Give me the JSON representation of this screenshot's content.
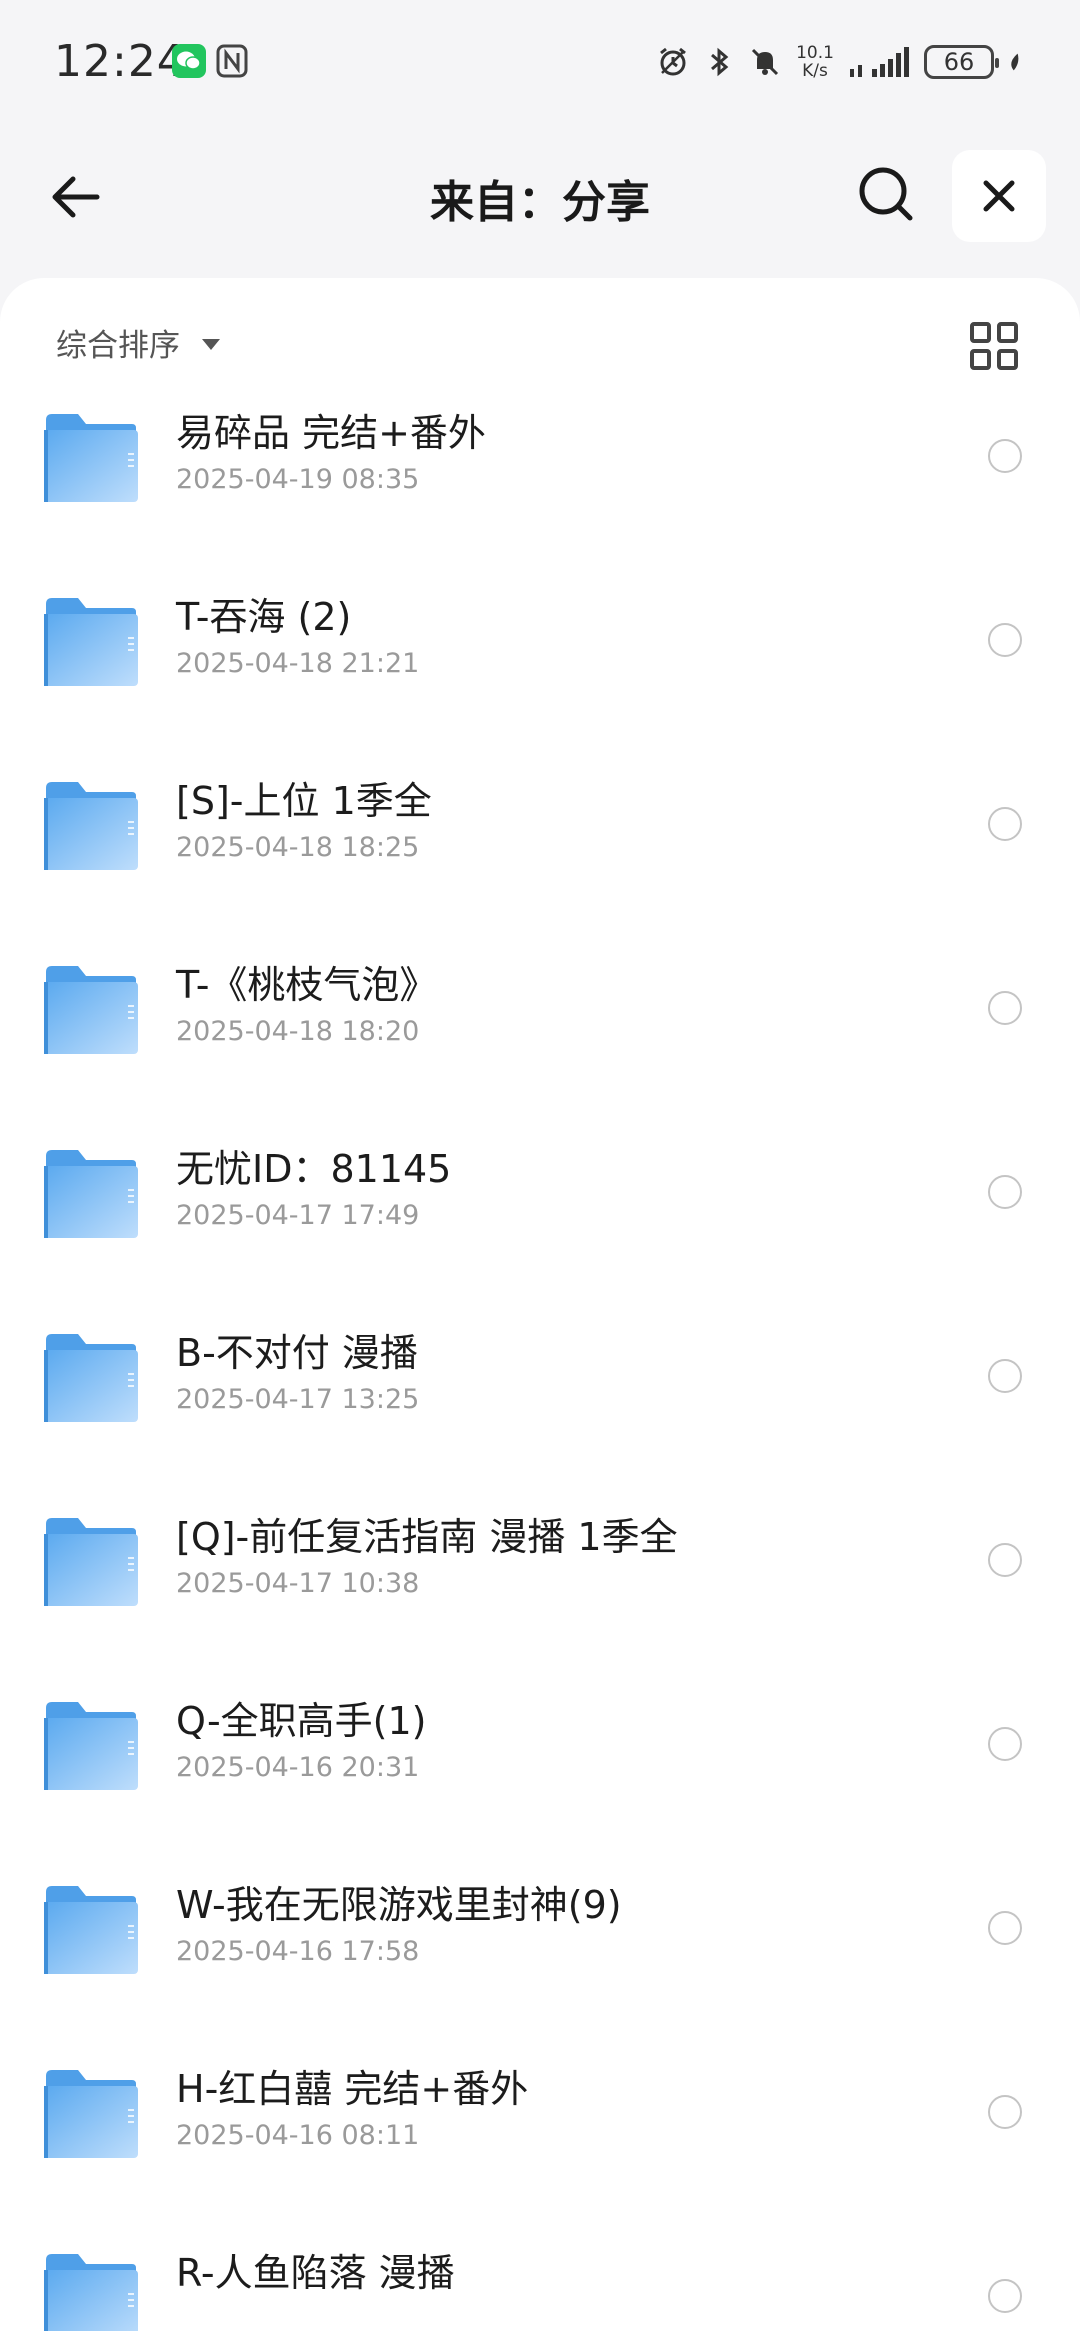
{
  "status_bar": {
    "time": "12:24",
    "net_speed_value": "10.1",
    "net_speed_unit": "K/s",
    "battery": "66",
    "icons": [
      "wechat-icon",
      "nfc-icon",
      "alarm-icon",
      "bluetooth-icon",
      "mute-icon",
      "signal-icon",
      "leaf-icon"
    ]
  },
  "header": {
    "title": "来自：分享",
    "back_icon": "arrow-left-icon",
    "search_icon": "search-icon",
    "close_icon": "close-icon"
  },
  "toolbar": {
    "sort_label": "综合排序",
    "view_icon": "grid-view-icon"
  },
  "colors": {
    "accent_folder": "#5aa9ef",
    "page_bg": "#f5f5f7",
    "panel_bg": "#ffffff"
  },
  "files": [
    {
      "name": "易碎品  完结+番外",
      "date": "2025-04-19 08:35"
    },
    {
      "name": "T-吞海 (2)",
      "date": "2025-04-18 21:21"
    },
    {
      "name": "[S]-上位 1季全",
      "date": "2025-04-18 18:25"
    },
    {
      "name": "T-《桃枝气泡》",
      "date": "2025-04-18 18:20"
    },
    {
      "name": "无忧ID：81145",
      "date": "2025-04-17 17:49"
    },
    {
      "name": "B-不对付 漫播",
      "date": "2025-04-17 13:25"
    },
    {
      "name": "[Q]-前任复活指南 漫播 1季全",
      "date": "2025-04-17 10:38"
    },
    {
      "name": "Q-全职高手(1)",
      "date": "2025-04-16 20:31"
    },
    {
      "name": "W-我在无限游戏里封神(9)",
      "date": "2025-04-16 17:58"
    },
    {
      "name": "H-红白囍 完结+番外",
      "date": "2025-04-16 08:11"
    },
    {
      "name": "R-人鱼陷落 漫播",
      "date": ""
    }
  ]
}
